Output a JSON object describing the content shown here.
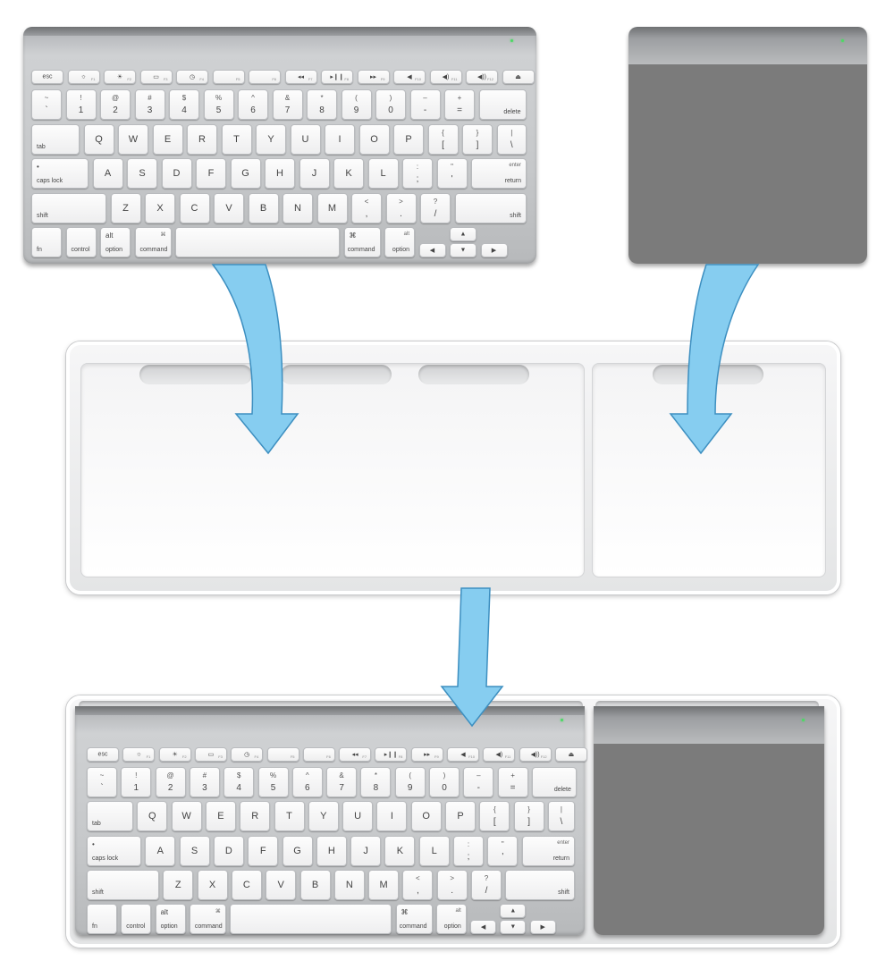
{
  "colors": {
    "arrow_fill": "#86cdf0",
    "arrow_stroke": "#3d8fc0",
    "trackpad_surface": "#7b7b7b",
    "led": "#4cd964"
  },
  "icons": {
    "brightness_down": "☼",
    "brightness_up": "☀",
    "expose": "▭",
    "dashboard": "◷",
    "rewind": "◂◂",
    "play_pause": "▸❙❙",
    "fast_forward": "▸▸",
    "mute": "◀",
    "volume_down": "◀)",
    "volume_up": "◀))",
    "eject": "⏏",
    "arrow_up": "▲",
    "arrow_down": "▼",
    "arrow_left": "◀",
    "arrow_right": "▶",
    "command_glyph": "⌘"
  },
  "keys": {
    "esc": "esc",
    "fn_labels": [
      "F1",
      "F2",
      "F3",
      "F4",
      "F5",
      "F6",
      "F7",
      "F8",
      "F9",
      "F10",
      "F11",
      "F12"
    ],
    "number_row": [
      {
        "top": "~",
        "bottom": "`"
      },
      {
        "top": "!",
        "bottom": "1"
      },
      {
        "top": "@",
        "bottom": "2"
      },
      {
        "top": "#",
        "bottom": "3"
      },
      {
        "top": "$",
        "bottom": "4"
      },
      {
        "top": "%",
        "bottom": "5"
      },
      {
        "top": "^",
        "bottom": "6"
      },
      {
        "top": "&",
        "bottom": "7"
      },
      {
        "top": "*",
        "bottom": "8"
      },
      {
        "top": "(",
        "bottom": "9"
      },
      {
        "top": ")",
        "bottom": "0"
      },
      {
        "top": "–",
        "bottom": "-"
      },
      {
        "top": "+",
        "bottom": "="
      }
    ],
    "delete": "delete",
    "tab": "tab",
    "row_q": [
      "Q",
      "W",
      "E",
      "R",
      "T",
      "Y",
      "U",
      "I",
      "O",
      "P"
    ],
    "bracket_open": {
      "top": "{",
      "bottom": "["
    },
    "bracket_close": {
      "top": "}",
      "bottom": "]"
    },
    "pipe": {
      "top": "|",
      "bottom": "\\"
    },
    "caps_lock": "caps lock",
    "row_a": [
      "A",
      "S",
      "D",
      "F",
      "G",
      "H",
      "J",
      "K",
      "L"
    ],
    "semicolon": {
      "top": ":",
      "bottom": ";"
    },
    "quote": {
      "top": "\"",
      "bottom": "'"
    },
    "return_top": "enter",
    "return": "return",
    "shift": "shift",
    "row_z": [
      "Z",
      "X",
      "C",
      "V",
      "B",
      "N",
      "M"
    ],
    "comma": {
      "top": "<",
      "bottom": ","
    },
    "period": {
      "top": ">",
      "bottom": "."
    },
    "slash": {
      "top": "?",
      "bottom": "/"
    },
    "fn": "fn",
    "control": "control",
    "alt": "alt",
    "option": "option",
    "command": "command"
  }
}
